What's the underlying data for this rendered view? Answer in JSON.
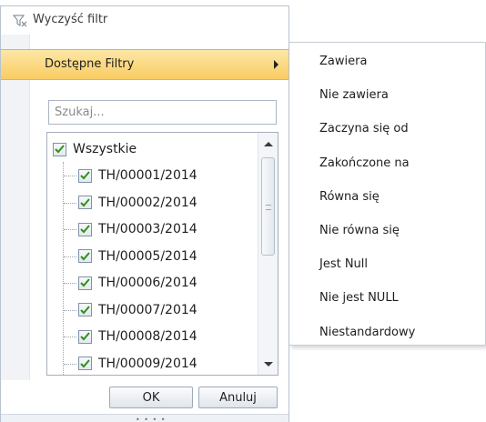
{
  "popup": {
    "clear_filter_label": "Wyczyść filtr",
    "available_filters_label": "Dostępne Filtry",
    "search_placeholder": "Szukaj...",
    "select_all_label": "Wszystkie",
    "items": [
      {
        "label": "TH/00001/2014",
        "checked": true
      },
      {
        "label": "TH/00002/2014",
        "checked": true
      },
      {
        "label": "TH/00003/2014",
        "checked": true
      },
      {
        "label": "TH/00005/2014",
        "checked": true
      },
      {
        "label": "TH/00006/2014",
        "checked": true
      },
      {
        "label": "TH/00007/2014",
        "checked": true
      },
      {
        "label": "TH/00008/2014",
        "checked": true
      },
      {
        "label": "TH/00009/2014",
        "checked": true
      }
    ],
    "ok_label": "OK",
    "cancel_label": "Anuluj",
    "grip_text": "• • • •"
  },
  "submenu": {
    "items": [
      "Zawiera",
      "Nie zawiera",
      "Zaczyna się od",
      "Zakończone na",
      "Równa się",
      "Nie równa się",
      "Jest Null",
      "Nie jest NULL",
      "Niestandardowy"
    ]
  },
  "icons": {
    "clear_filter": "funnel-clear-icon",
    "submenu_arrow": "chevron-right-icon",
    "checkbox": "checkmark-icon"
  },
  "colors": {
    "highlight_top": "#fde7a6",
    "highlight_bottom": "#f9cc62",
    "check": "#2f8f1e",
    "border": "#b9c3d0"
  }
}
